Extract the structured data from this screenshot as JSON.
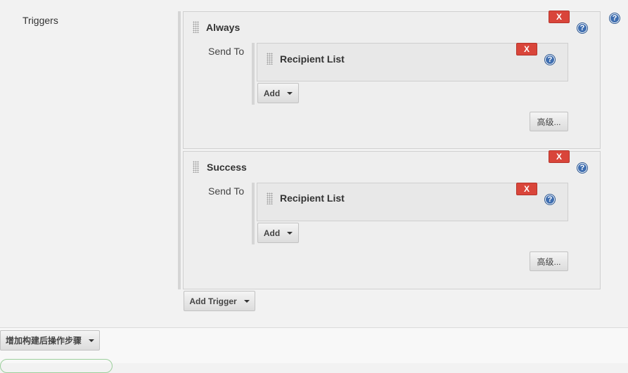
{
  "section": {
    "label": "Triggers"
  },
  "triggers": [
    {
      "title": "Always",
      "send_to": "Send To",
      "recipient": "Recipient List",
      "add": "Add",
      "advanced": "高级...",
      "delete": "X",
      "recipient_delete": "X"
    },
    {
      "title": "Success",
      "send_to": "Send To",
      "recipient": "Recipient List",
      "add": "Add",
      "advanced": "高级...",
      "delete": "X",
      "recipient_delete": "X"
    }
  ],
  "add_trigger": "Add Trigger",
  "post_build": "增加构建后操作步骤",
  "help_glyph": "?",
  "icons": [
    "help-icon",
    "drag-handle-icon",
    "caret-down-icon"
  ],
  "colors": {
    "delete_red": "#d9453a",
    "help_blue": "#3f6eb0",
    "panel_bg": "#eeeeee"
  }
}
